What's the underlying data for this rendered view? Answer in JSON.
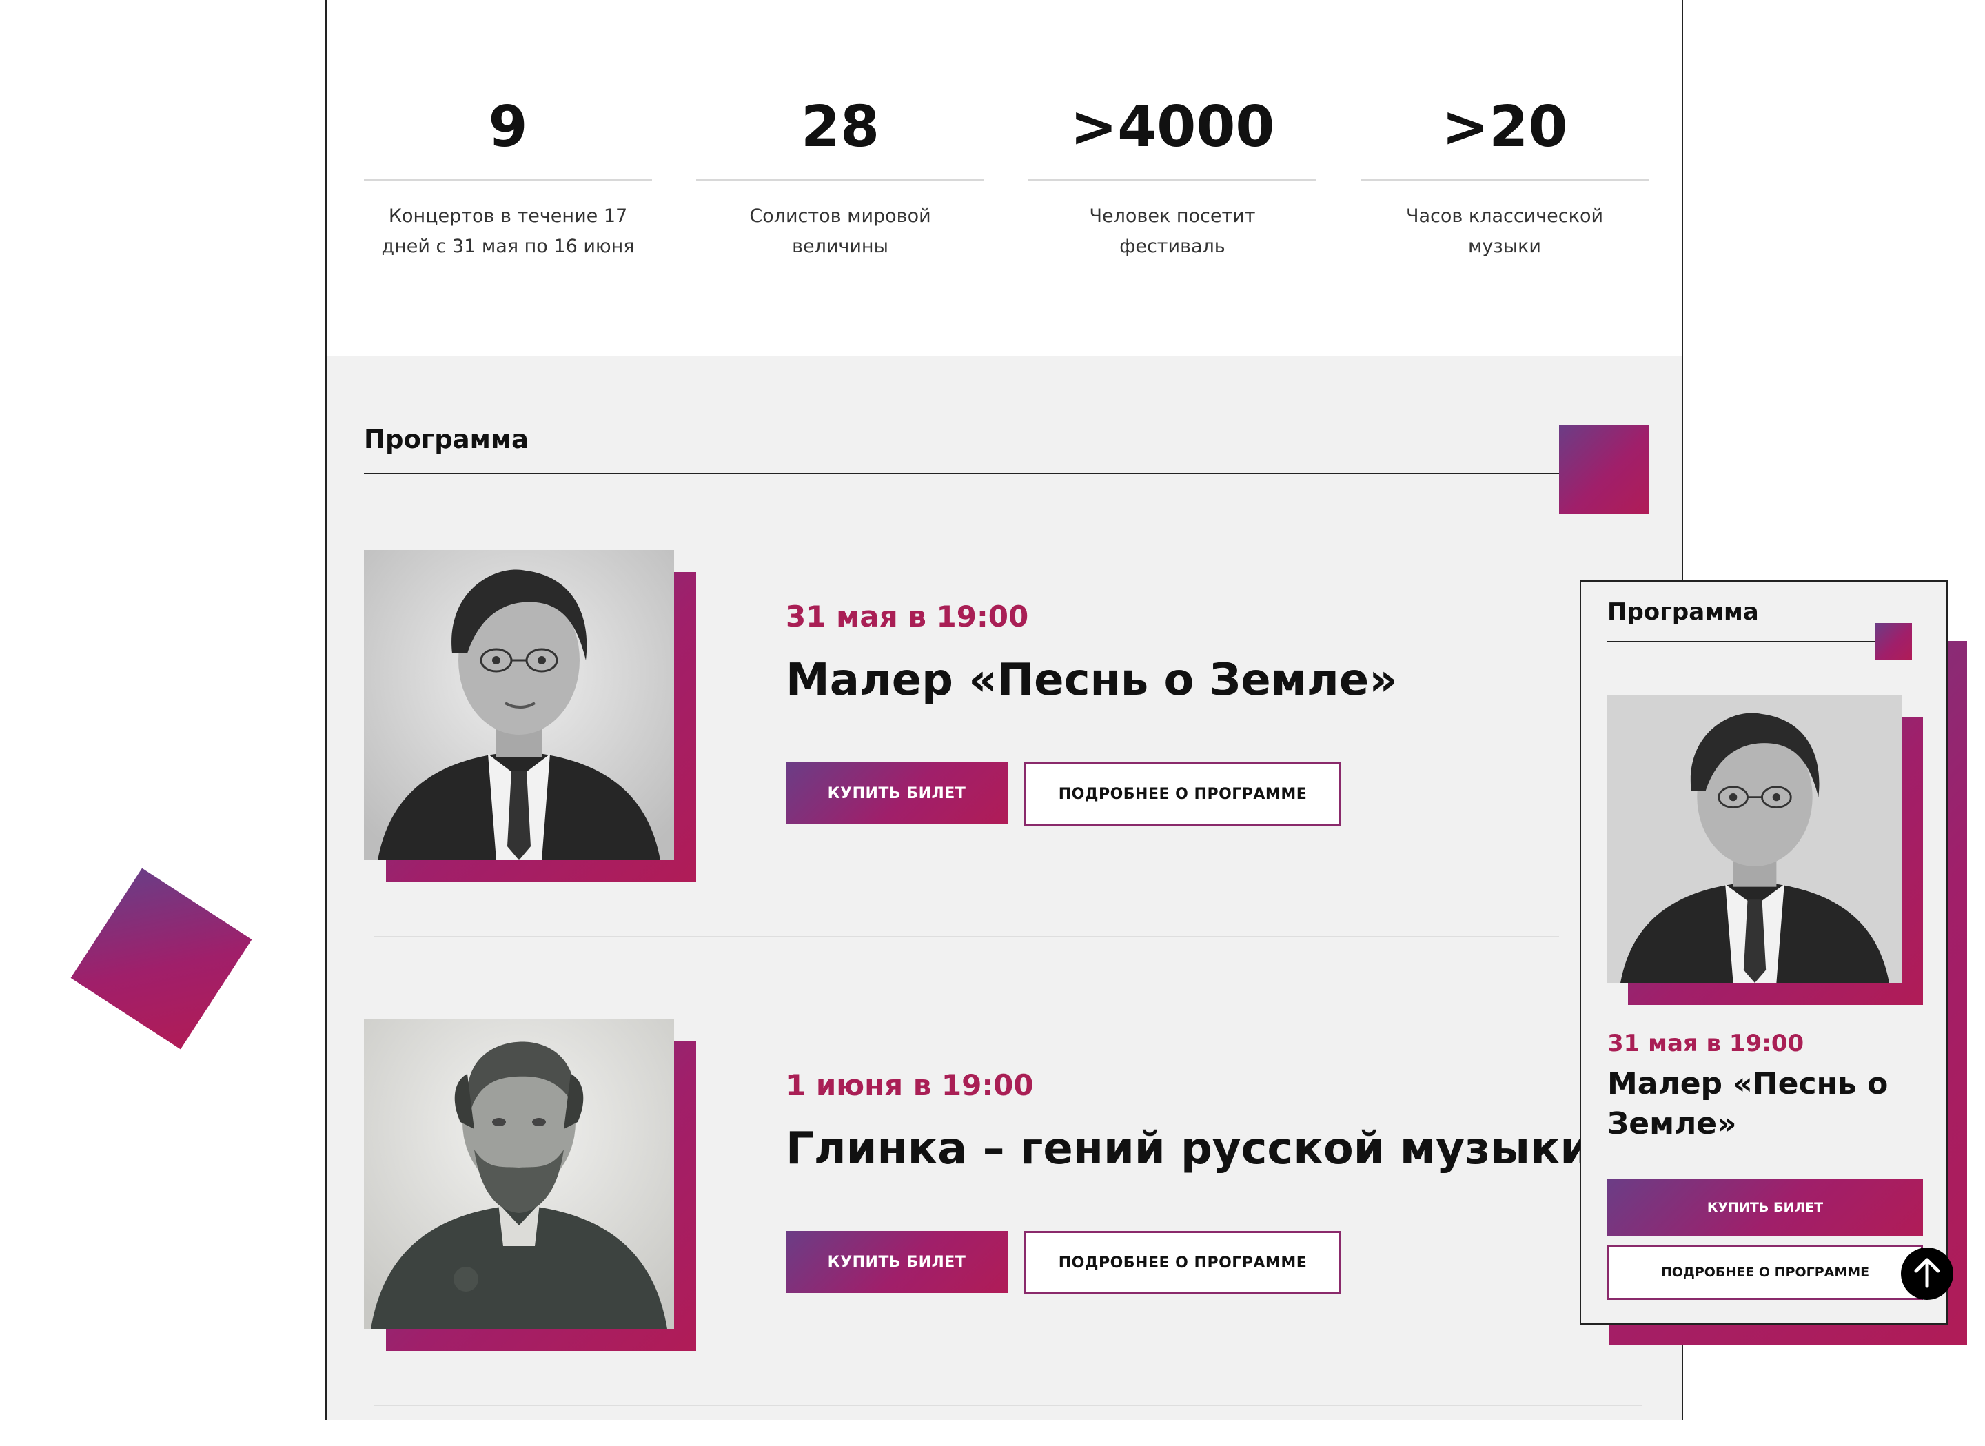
{
  "stats": [
    {
      "number": "9",
      "description": "Концертов в течение 17 дней с 31 мая по 16 июня"
    },
    {
      "number": "28",
      "description": "Солистов мировой величины"
    },
    {
      "number": ">4000",
      "description": "Человек посетит фестиваль"
    },
    {
      "number": ">20",
      "description": "Часов классической музыки"
    }
  ],
  "program": {
    "title": "Программа",
    "events": [
      {
        "date": "31 мая в 19:00",
        "title": "Малер «Песнь о Земле»",
        "buy_label": "КУПИТЬ БИЛЕТ",
        "more_label": "ПОДРОБНЕЕ О ПРОГРАММЕ"
      },
      {
        "date": "1 июня в 19:00",
        "title": "Глинка – гений русской музыки",
        "buy_label": "КУПИТЬ БИЛЕТ",
        "more_label": "ПОДРОБНЕЕ О ПРОГРАММЕ"
      }
    ]
  },
  "mobile": {
    "title": "Программа",
    "event": {
      "date": "31 мая в 19:00",
      "title": "Малер «Песнь о Земле»",
      "buy_label": "КУПИТЬ БИЛЕТ",
      "more_label": "ПОДРОБНЕЕ О ПРОГРАММЕ"
    }
  },
  "colors": {
    "accent": "#a91f55",
    "gradient_start": "#6b3d86",
    "gradient_end": "#b01c57"
  },
  "icons": {
    "scroll_top": "arrow-up-icon"
  }
}
